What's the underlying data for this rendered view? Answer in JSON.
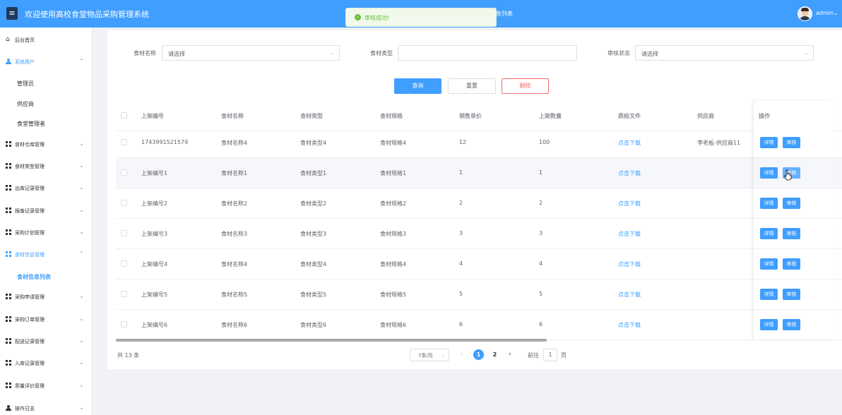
{
  "header": {
    "menu_icon": "hamburger-icon",
    "title": "欢迎使用高校食堂物品采购管理系统",
    "tab_peek": "息列表",
    "user": "admin",
    "user_caret": "⌄"
  },
  "toast": {
    "message": "审核成功!",
    "icon": "check-circle-icon",
    "color": "#67c23a"
  },
  "sidebar": {
    "items": [
      {
        "label": "后台首页",
        "icon": "home-icon"
      },
      {
        "label": "系统用户",
        "icon": "user-icon",
        "arrow": "⌃"
      },
      {
        "label": "管理员"
      },
      {
        "label": "供应商"
      },
      {
        "label": "食堂管理者"
      },
      {
        "label": "食材仓库管理",
        "icon": "grid-icon",
        "arrow": "⌄"
      },
      {
        "label": "食材类型管理",
        "icon": "grid-icon",
        "arrow": "⌄"
      },
      {
        "label": "出库记录管理",
        "icon": "grid-icon",
        "arrow": "⌄"
      },
      {
        "label": "报废记录管理",
        "icon": "grid-icon",
        "arrow": "⌄"
      },
      {
        "label": "采购计划管理",
        "icon": "grid-icon",
        "arrow": "⌄"
      },
      {
        "label": "食材信息管理",
        "icon": "grid-icon",
        "arrow": "⌃"
      },
      {
        "label": "食材信息列表"
      },
      {
        "label": "采购申请管理",
        "icon": "grid-icon",
        "arrow": "⌄"
      },
      {
        "label": "采购订单管理",
        "icon": "grid-icon",
        "arrow": "⌄"
      },
      {
        "label": "配送记录管理",
        "icon": "grid-icon",
        "arrow": "⌄"
      },
      {
        "label": "入库记录管理",
        "icon": "grid-icon",
        "arrow": "⌄"
      },
      {
        "label": "质量评价管理",
        "icon": "grid-icon",
        "arrow": "⌄"
      },
      {
        "label": "操作日志",
        "icon": "user-icon",
        "arrow": "⌄"
      }
    ]
  },
  "filters": {
    "name_label": "食材名称",
    "name_value": "请选择",
    "type_label": "食材类型",
    "type_value": "",
    "status_label": "审核状态",
    "status_value": "请选择"
  },
  "actions": {
    "search": "查询",
    "reset": "重置",
    "delete": "删除"
  },
  "table": {
    "headers": [
      "上架编号",
      "食材名称",
      "食材类型",
      "食材规格",
      "销售单价",
      "上架数量",
      "质检文件",
      "供应商",
      "操作"
    ],
    "rows": [
      [
        "1743991521579",
        "食材名称4",
        "食材类型4",
        "食材规格4",
        "12",
        "100",
        "点击下载",
        "李老板-供应商11"
      ],
      [
        "上架编号1",
        "食材名称1",
        "食材类型1",
        "食材规格1",
        "1",
        "1",
        "点击下载",
        ""
      ],
      [
        "上架编号2",
        "食材名称2",
        "食材类型2",
        "食材规格2",
        "2",
        "2",
        "点击下载",
        ""
      ],
      [
        "上架编号3",
        "食材名称3",
        "食材类型3",
        "食材规格3",
        "3",
        "3",
        "点击下载",
        ""
      ],
      [
        "上架编号4",
        "食材名称4",
        "食材类型4",
        "食材规格4",
        "4",
        "4",
        "点击下载",
        ""
      ],
      [
        "上架编号5",
        "食材名称5",
        "食材类型5",
        "食材规格5",
        "5",
        "5",
        "点击下载",
        ""
      ],
      [
        "上架编号6",
        "食材名称6",
        "食材类型6",
        "食材规格6",
        "6",
        "6",
        "点击下载",
        ""
      ]
    ],
    "row_actions": {
      "detail": "详情",
      "review": "审核"
    }
  },
  "pagination": {
    "total": "共 13 条",
    "page_size": "7条/页",
    "size_caret": "⌄",
    "prev": "‹",
    "next": "›",
    "pages": [
      "1",
      "2"
    ],
    "goto_prefix": "前往",
    "goto_value": "1",
    "goto_suffix": "页"
  },
  "colors": {
    "primary": "#409eff",
    "danger": "#f56c6c",
    "success": "#67c23a"
  }
}
